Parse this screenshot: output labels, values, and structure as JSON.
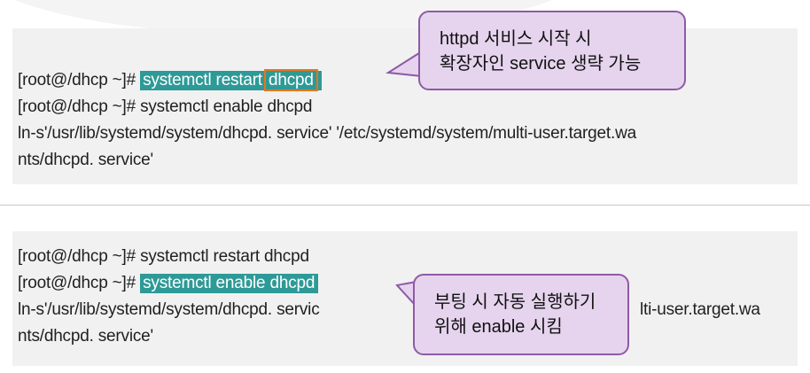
{
  "panel1": {
    "line1_prefix": "[root@/dhcp ~]#",
    "line1_cmd": "systemctl restart",
    "line1_arg": "dhcpd",
    "line2": "[root@/dhcp ~]# systemctl enable dhcpd",
    "line3": "ln-s'/usr/lib/systemd/system/dhcpd. service' '/etc/systemd/system/multi-user.target.wa",
    "line4": "nts/dhcpd. service'"
  },
  "callout1": {
    "line1": "httpd 서비스 시작 시",
    "line2": "확장자인 service 생략 가능"
  },
  "panel2": {
    "line1": "[root@/dhcp ~]# systemctl restart dhcpd",
    "line2_prefix": "[root@/dhcp ~]#",
    "line2_cmd": "systemctl enable dhcpd",
    "line3_left": "ln-s'/usr/lib/systemd/system/dhcpd. servic",
    "line3_right": "lti-user.target.wa",
    "line4": "nts/dhcpd. service'"
  },
  "callout2": {
    "line1": "부팅 시 자동 실행하기",
    "line2": "위해 enable 시킴"
  },
  "colors": {
    "highlight": "#2e9a97",
    "orange_box": "#e8751a",
    "callout_fill": "#e6d4ee",
    "callout_border": "#8e5aa6"
  }
}
